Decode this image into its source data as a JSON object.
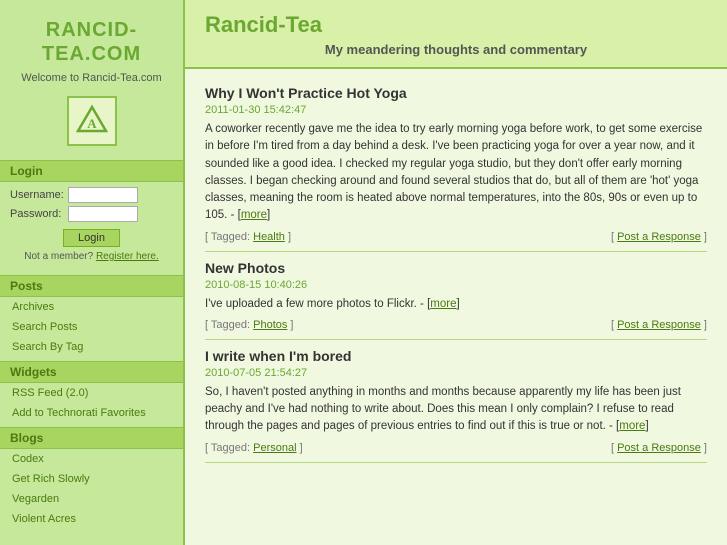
{
  "sidebar": {
    "site_title": "Rancid-\nTea.com",
    "welcome_text": "Welcome to Rancid-Tea.com",
    "sections": {
      "login": {
        "header": "Login",
        "username_label": "Username:",
        "password_label": "Password:",
        "login_button": "Login",
        "not_member_text": "Not a member?",
        "register_link": "Register here."
      },
      "posts": {
        "header": "Posts",
        "items": [
          {
            "label": "Archives",
            "href": "#"
          },
          {
            "label": "Search Posts",
            "href": "#"
          },
          {
            "label": "Search By Tag",
            "href": "#"
          }
        ]
      },
      "widgets": {
        "header": "Widgets",
        "items": [
          {
            "label": "RSS Feed (2.0)",
            "href": "#"
          },
          {
            "label": "Add to Technorati Favorites",
            "href": "#"
          }
        ]
      },
      "blogs": {
        "header": "Blogs",
        "items": [
          {
            "label": "Codex",
            "href": "#"
          },
          {
            "label": "Get Rich Slowly",
            "href": "#"
          },
          {
            "label": "Vegarden",
            "href": "#"
          },
          {
            "label": "Violent Acres",
            "href": "#"
          }
        ]
      }
    }
  },
  "main": {
    "title": "Rancid-Tea",
    "subtitle": "My meandering thoughts and commentary",
    "posts": [
      {
        "id": "post1",
        "title": "Why I Won't Practice Hot Yoga",
        "date": "2011-01-30 15:42:47",
        "body": "A coworker recently gave me the idea to try early morning yoga before work, to get some exercise in before I'm tired from a day behind a desk. I've been practicing yoga for over a year now, and it sounded like a good idea. I checked my regular yoga studio, but they don't offer early morning classes. I began checking around and found several studios that do, but all of them are 'hot' yoga classes, meaning the room is heated above normal temperatures, into the 80s, 90s or even up to 105. - [more]",
        "more_link": "#",
        "tag": "Health",
        "tag_link": "#",
        "response_text": "Post a Response",
        "response_link": "#"
      },
      {
        "id": "post2",
        "title": "New Photos",
        "date": "2010-08-15 10:40:26",
        "body": "I've uploaded a few more photos to Flickr. - [more]",
        "more_link": "#",
        "tag": "Photos",
        "tag_link": "#",
        "response_text": "Post a Response",
        "response_link": "#"
      },
      {
        "id": "post3",
        "title": "I write when I'm bored",
        "date": "2010-07-05 21:54:27",
        "body": "So, I haven't posted anything in months and months because apparently my life has been just peachy and I've had nothing to write about. Does this mean I only complain? I refuse to read through the pages and pages of previous entries to find out if this is true or not. - [more]",
        "more_link": "#",
        "tag": "Personal",
        "tag_link": "#",
        "response_text": "Post a Response",
        "response_link": "#"
      }
    ]
  }
}
